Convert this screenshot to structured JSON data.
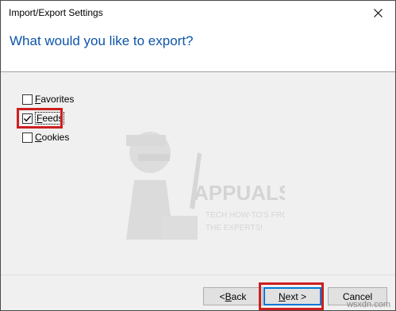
{
  "window": {
    "title": "Import/Export Settings",
    "close_icon": "close-icon"
  },
  "header": {
    "heading": "What would you like to export?"
  },
  "options": [
    {
      "label_acc": "F",
      "label_rest": "avorites",
      "checked": false
    },
    {
      "label_acc": "F",
      "label_rest": "eeds",
      "checked": true,
      "focused": true,
      "highlighted": true
    },
    {
      "label_acc": "C",
      "label_rest": "ookies",
      "checked": false
    }
  ],
  "watermark": {
    "brand": "APPUALS",
    "tagline1": "TECH HOW-TO'S FROM",
    "tagline2": "THE EXPERTS!"
  },
  "footer": {
    "back": {
      "prefix": "< ",
      "acc": "B",
      "rest": "ack"
    },
    "next": {
      "acc": "N",
      "rest": "ext >",
      "highlighted": true
    },
    "cancel": {
      "label": "Cancel"
    }
  },
  "corner_watermark": "wsxdn.com",
  "colors": {
    "heading": "#0d55a8",
    "highlight_border": "#cc1f1f",
    "default_button_border": "#0078d7"
  }
}
